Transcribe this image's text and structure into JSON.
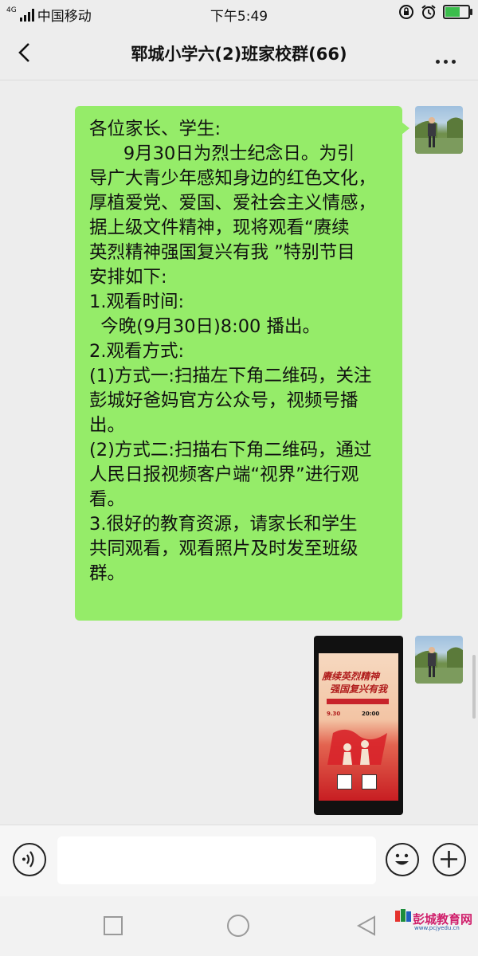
{
  "status_bar": {
    "network": "4G",
    "carrier": "中国移动",
    "time": "下午5:49",
    "battery_level": 0.6
  },
  "header": {
    "title": "郓城小学六(2)班家校群(66)"
  },
  "messages": {
    "text_lines": [
      "各位家长、学生:",
      "      9月30日为烈士纪念日。为引",
      "导广大青少年感知身边的红色文化，",
      "厚植爱党、爱国、爱社会主义情感，",
      "据上级文件精神，现将观看“赓续",
      "英烈精神强国复兴有我 ”特别节目",
      "安排如下:",
      "1.观看时间:",
      "  今晚(9月30日)8:00 播出。",
      "2.观看方式:",
      "(1)方式一:扫描左下角二维码，关注",
      "彭城好爸妈官方公众号，视频号播",
      "出。",
      "(2)方式二:扫描右下角二维码，通过",
      "人民日报视频客户端“视界”进行观",
      "看。",
      "3.很好的教育资源，请家长和学生",
      "共同观看，观看照片及时发至班级",
      "群。"
    ],
    "poster": {
      "title_line1": "赓续英烈精神",
      "title_line2": "强国复兴有我",
      "date": "9.30",
      "time": "20:00"
    }
  },
  "watermark": {
    "text": "彭城教育网",
    "url": "www.pcjyedu.cn"
  },
  "colors": {
    "bubble": "#95ec69",
    "background": "#ededed"
  }
}
